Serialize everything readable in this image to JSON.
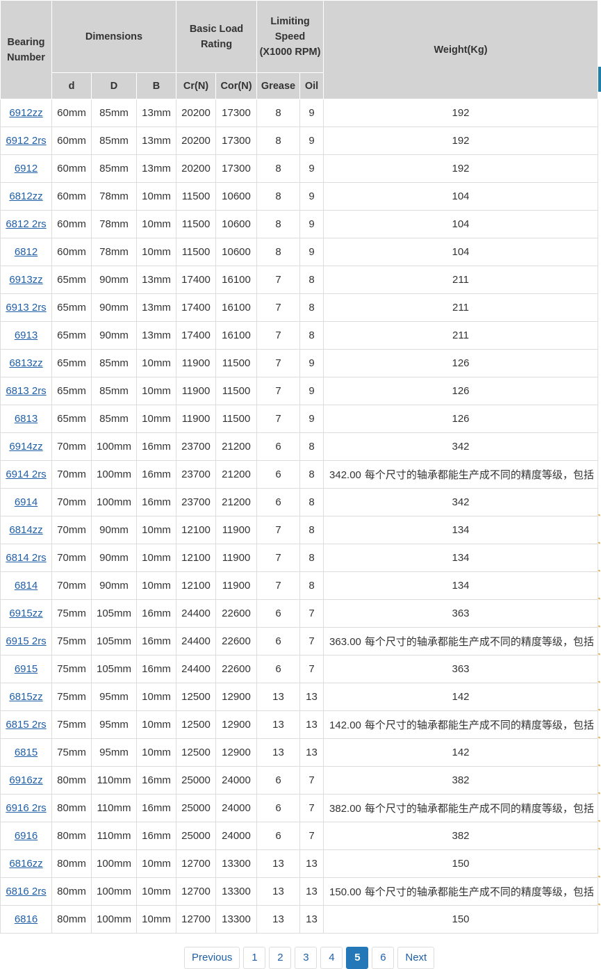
{
  "header": {
    "bearing_number": "Bearing Number",
    "dimensions": "Dimensions",
    "basic_load_rating": "Basic Load Rating",
    "limiting_speed": "Limiting Speed (X1000 RPM)",
    "weight": "Weight(Kg)",
    "sub": {
      "d": "d",
      "D": "D",
      "B": "B",
      "cr": "Cr(N)",
      "cor": "Cor(N)",
      "grease": "Grease",
      "oil": "Oil"
    }
  },
  "rows": [
    {
      "num": "6912zz",
      "d": "60mm",
      "D": "85mm",
      "B": "13mm",
      "cr": "20200",
      "cor": "17300",
      "grease": "8",
      "oil": "9",
      "weight": "192",
      "note": ""
    },
    {
      "num": "6912 2rs",
      "d": "60mm",
      "D": "85mm",
      "B": "13mm",
      "cr": "20200",
      "cor": "17300",
      "grease": "8",
      "oil": "9",
      "weight": "192",
      "note": ""
    },
    {
      "num": "6912",
      "d": "60mm",
      "D": "85mm",
      "B": "13mm",
      "cr": "20200",
      "cor": "17300",
      "grease": "8",
      "oil": "9",
      "weight": "192",
      "note": ""
    },
    {
      "num": "6812zz",
      "d": "60mm",
      "D": "78mm",
      "B": "10mm",
      "cr": "11500",
      "cor": "10600",
      "grease": "8",
      "oil": "9",
      "weight": "104",
      "note": ""
    },
    {
      "num": "6812 2rs",
      "d": "60mm",
      "D": "78mm",
      "B": "10mm",
      "cr": "11500",
      "cor": "10600",
      "grease": "8",
      "oil": "9",
      "weight": "104",
      "note": ""
    },
    {
      "num": "6812",
      "d": "60mm",
      "D": "78mm",
      "B": "10mm",
      "cr": "11500",
      "cor": "10600",
      "grease": "8",
      "oil": "9",
      "weight": "104",
      "note": ""
    },
    {
      "num": "6913zz",
      "d": "65mm",
      "D": "90mm",
      "B": "13mm",
      "cr": "17400",
      "cor": "16100",
      "grease": "7",
      "oil": "8",
      "weight": "211",
      "note": ""
    },
    {
      "num": "6913 2rs",
      "d": "65mm",
      "D": "90mm",
      "B": "13mm",
      "cr": "17400",
      "cor": "16100",
      "grease": "7",
      "oil": "8",
      "weight": "211",
      "note": ""
    },
    {
      "num": "6913",
      "d": "65mm",
      "D": "90mm",
      "B": "13mm",
      "cr": "17400",
      "cor": "16100",
      "grease": "7",
      "oil": "8",
      "weight": "211",
      "note": ""
    },
    {
      "num": "6813zz",
      "d": "65mm",
      "D": "85mm",
      "B": "10mm",
      "cr": "11900",
      "cor": "11500",
      "grease": "7",
      "oil": "9",
      "weight": "126",
      "note": ""
    },
    {
      "num": "6813 2rs",
      "d": "65mm",
      "D": "85mm",
      "B": "10mm",
      "cr": "11900",
      "cor": "11500",
      "grease": "7",
      "oil": "9",
      "weight": "126",
      "note": ""
    },
    {
      "num": "6813",
      "d": "65mm",
      "D": "85mm",
      "B": "10mm",
      "cr": "11900",
      "cor": "11500",
      "grease": "7",
      "oil": "9",
      "weight": "126",
      "note": ""
    },
    {
      "num": "6914zz",
      "d": "70mm",
      "D": "100mm",
      "B": "16mm",
      "cr": "23700",
      "cor": "21200",
      "grease": "6",
      "oil": "8",
      "weight": "342",
      "note": ""
    },
    {
      "num": "6914 2rs",
      "d": "70mm",
      "D": "100mm",
      "B": "16mm",
      "cr": "23700",
      "cor": "21200",
      "grease": "6",
      "oil": "8",
      "weight": "342.00",
      "note": "每个尺寸的轴承都能生产成不同的精度等级，包括"
    },
    {
      "num": "6914",
      "d": "70mm",
      "D": "100mm",
      "B": "16mm",
      "cr": "23700",
      "cor": "21200",
      "grease": "6",
      "oil": "8",
      "weight": "342",
      "note": ""
    },
    {
      "num": "6814zz",
      "d": "70mm",
      "D": "90mm",
      "B": "10mm",
      "cr": "12100",
      "cor": "11900",
      "grease": "7",
      "oil": "8",
      "weight": "134",
      "note": ""
    },
    {
      "num": "6814 2rs",
      "d": "70mm",
      "D": "90mm",
      "B": "10mm",
      "cr": "12100",
      "cor": "11900",
      "grease": "7",
      "oil": "8",
      "weight": "134",
      "note": ""
    },
    {
      "num": "6814",
      "d": "70mm",
      "D": "90mm",
      "B": "10mm",
      "cr": "12100",
      "cor": "11900",
      "grease": "7",
      "oil": "8",
      "weight": "134",
      "note": ""
    },
    {
      "num": "6915zz",
      "d": "75mm",
      "D": "105mm",
      "B": "16mm",
      "cr": "24400",
      "cor": "22600",
      "grease": "6",
      "oil": "7",
      "weight": "363",
      "note": ""
    },
    {
      "num": "6915 2rs",
      "d": "75mm",
      "D": "105mm",
      "B": "16mm",
      "cr": "24400",
      "cor": "22600",
      "grease": "6",
      "oil": "7",
      "weight": "363.00",
      "note": "每个尺寸的轴承都能生产成不同的精度等级，包括"
    },
    {
      "num": "6915",
      "d": "75mm",
      "D": "105mm",
      "B": "16mm",
      "cr": "24400",
      "cor": "22600",
      "grease": "6",
      "oil": "7",
      "weight": "363",
      "note": ""
    },
    {
      "num": "6815zz",
      "d": "75mm",
      "D": "95mm",
      "B": "10mm",
      "cr": "12500",
      "cor": "12900",
      "grease": "13",
      "oil": "13",
      "weight": "142",
      "note": ""
    },
    {
      "num": "6815 2rs",
      "d": "75mm",
      "D": "95mm",
      "B": "10mm",
      "cr": "12500",
      "cor": "12900",
      "grease": "13",
      "oil": "13",
      "weight": "142.00",
      "note": "每个尺寸的轴承都能生产成不同的精度等级，包括"
    },
    {
      "num": "6815",
      "d": "75mm",
      "D": "95mm",
      "B": "10mm",
      "cr": "12500",
      "cor": "12900",
      "grease": "13",
      "oil": "13",
      "weight": "142",
      "note": ""
    },
    {
      "num": "6916zz",
      "d": "80mm",
      "D": "110mm",
      "B": "16mm",
      "cr": "25000",
      "cor": "24000",
      "grease": "6",
      "oil": "7",
      "weight": "382",
      "note": ""
    },
    {
      "num": "6916 2rs",
      "d": "80mm",
      "D": "110mm",
      "B": "16mm",
      "cr": "25000",
      "cor": "24000",
      "grease": "6",
      "oil": "7",
      "weight": "382.00",
      "note": "每个尺寸的轴承都能生产成不同的精度等级，包括"
    },
    {
      "num": "6916",
      "d": "80mm",
      "D": "110mm",
      "B": "16mm",
      "cr": "25000",
      "cor": "24000",
      "grease": "6",
      "oil": "7",
      "weight": "382",
      "note": ""
    },
    {
      "num": "6816zz",
      "d": "80mm",
      "D": "100mm",
      "B": "10mm",
      "cr": "12700",
      "cor": "13300",
      "grease": "13",
      "oil": "13",
      "weight": "150",
      "note": ""
    },
    {
      "num": "6816 2rs",
      "d": "80mm",
      "D": "100mm",
      "B": "10mm",
      "cr": "12700",
      "cor": "13300",
      "grease": "13",
      "oil": "13",
      "weight": "150.00",
      "note": "每个尺寸的轴承都能生产成不同的精度等级，包括"
    },
    {
      "num": "6816",
      "d": "80mm",
      "D": "100mm",
      "B": "10mm",
      "cr": "12700",
      "cor": "13300",
      "grease": "13",
      "oil": "13",
      "weight": "150",
      "note": ""
    }
  ],
  "pagination": {
    "previous": "Previous",
    "pages": [
      "1",
      "2",
      "3",
      "4",
      "5",
      "6"
    ],
    "current": "5",
    "next": "Next"
  },
  "colors": {
    "header_bg": "#d3d3d3",
    "link": "#1f5fa8",
    "active_page": "#2478b8"
  }
}
